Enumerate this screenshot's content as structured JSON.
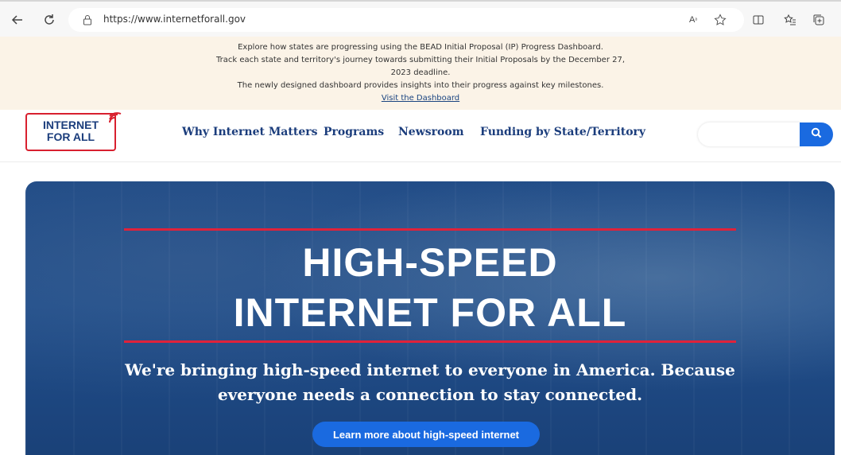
{
  "browser": {
    "url": "https://www.internetforall.gov",
    "icons": {
      "back": "back-arrow-icon",
      "refresh": "refresh-icon",
      "lock": "lock-icon",
      "read_aloud": "read-aloud-icon",
      "favorite": "star-icon",
      "split": "split-screen-icon",
      "favorites_bar": "favorites-icon",
      "collections": "collections-icon"
    }
  },
  "banner": {
    "line1": "Explore how states are progressing using the BEAD Initial Proposal (IP) Progress Dashboard.",
    "line2": "Track each state and territory's journey towards submitting their Initial Proposals by the December 27,",
    "line3": "2023 deadline.",
    "line4": "The newly designed dashboard provides insights into their progress against key milestones.",
    "link": "Visit the Dashboard"
  },
  "header": {
    "logo_line1": "INTERNET",
    "logo_line2": "FOR ALL",
    "nav": [
      "Why Internet Matters",
      "Programs",
      "Newsroom",
      "Funding by State/Territory"
    ],
    "search_placeholder": ""
  },
  "hero": {
    "title_line1": "HIGH-SPEED",
    "title_line2": "INTERNET FOR ALL",
    "subtitle_line1": "We're bringing high-speed internet to everyone in America. Because",
    "subtitle_line2": "everyone needs a connection to stay connected.",
    "button": "Learn more about high-speed internet"
  },
  "colors": {
    "brand_navy": "#1b3d7c",
    "brand_red": "#d8202f",
    "accent_blue": "#1a6ae0",
    "banner_bg": "#fbf3e7"
  }
}
